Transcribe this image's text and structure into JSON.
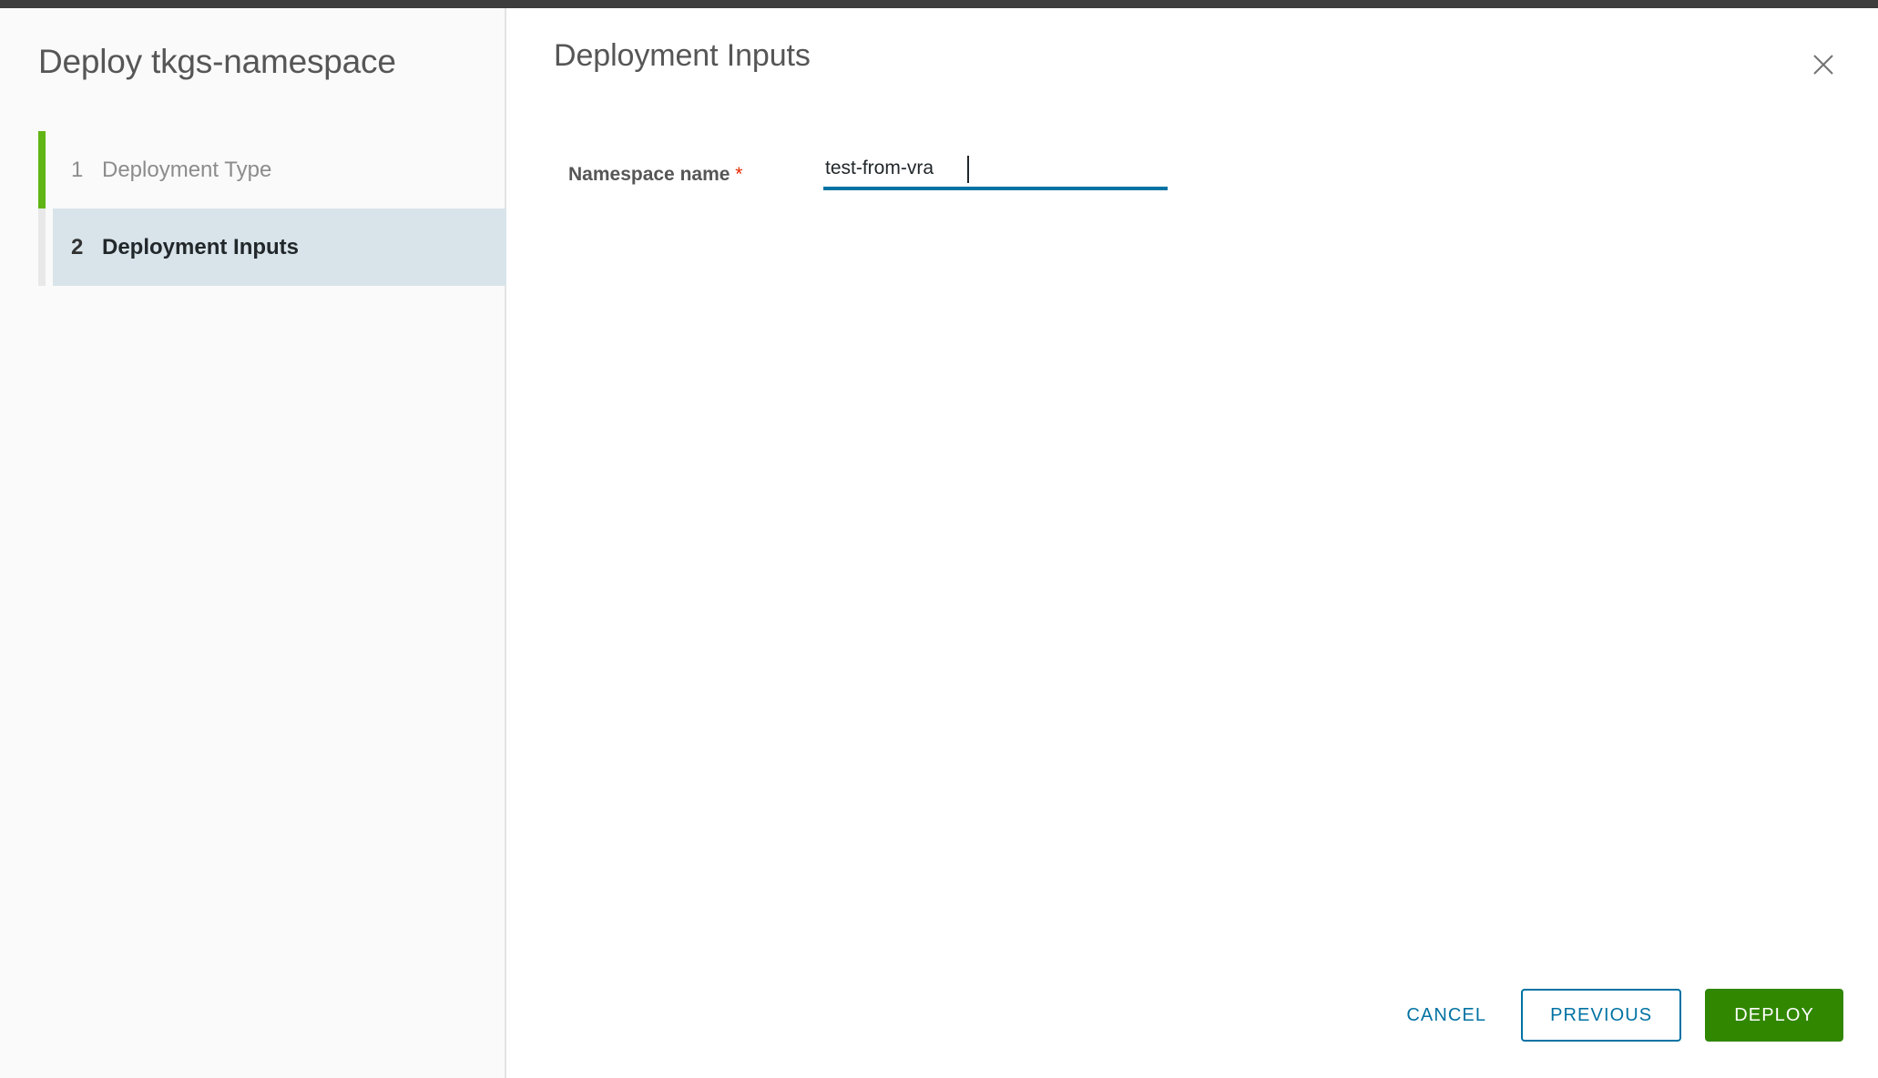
{
  "window": {
    "wizard_title": "Deploy tkgs-namespace"
  },
  "sidebar": {
    "steps": [
      {
        "number": "1",
        "label": "Deployment Type",
        "state": "completed"
      },
      {
        "number": "2",
        "label": "Deployment Inputs",
        "state": "active"
      }
    ]
  },
  "content": {
    "header": "Deployment Inputs",
    "close_icon": "close-icon",
    "form": {
      "fields": [
        {
          "label": "Namespace name",
          "required_marker": "*",
          "value": "test-from-vra",
          "placeholder": ""
        }
      ]
    }
  },
  "footer": {
    "cancel_label": "Cancel",
    "previous_label": "Previous",
    "deploy_label": "Deploy"
  },
  "colors": {
    "accent_blue": "#0072a3",
    "success_green": "#60b515",
    "deploy_green": "#318700",
    "required_red": "#e62700",
    "active_step_bg": "#d9e4ea",
    "top_strip": "#3d3d3d"
  }
}
